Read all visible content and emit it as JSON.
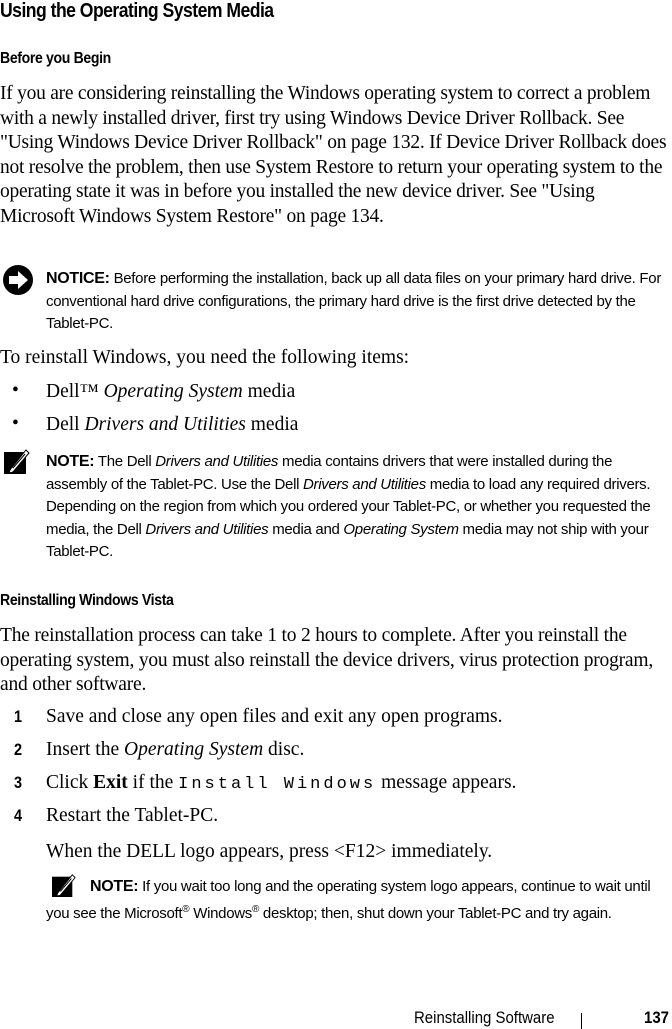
{
  "title": "Using the Operating System Media",
  "before": {
    "heading": "Before you Begin",
    "paragraph": "If you are considering reinstalling the Windows operating system to correct a problem with a newly installed driver, first try using Windows Device Driver Rollback. See \"Using Windows Device Driver Rollback\" on page 132. If Device Driver Rollback does not resolve the problem, then use System Restore to return your operating system to the operating state it was in before you installed the new device driver. See \"Using Microsoft Windows System Restore\" on page 134."
  },
  "notice": {
    "label": "NOTICE:",
    "text": "Before performing the installation, back up all data files on your primary hard drive. For conventional hard drive configurations, the primary hard drive is the first drive detected by the Tablet-PC."
  },
  "items_intro": "To reinstall Windows, you need the following items:",
  "items": [
    {
      "prefix": "Dell™ ",
      "italic": "Operating System",
      "suffix": " media"
    },
    {
      "prefix": "Dell ",
      "italic": "Drivers and Utilities",
      "suffix": " media"
    }
  ],
  "note1": {
    "label": "NOTE:",
    "t1": "The Dell ",
    "i1": "Drivers and Utilities",
    "t2": " media contains drivers that were installed during the assembly of the Tablet-PC. Use the Dell ",
    "i2": "Drivers and Utilities",
    "t3": " media to load any required drivers. Depending on the region from which you ordered your Tablet-PC, or whether you requested the media, the Dell ",
    "i3": "Drivers and Utilities",
    "t4": " media and ",
    "i4": "Operating System",
    "t5": " media may not ship with your Tablet-PC."
  },
  "vista": {
    "heading": "Reinstalling Windows Vista",
    "paragraph": "The reinstallation process can take 1 to 2 hours to complete. After you reinstall the operating system, you must also reinstall the device drivers, virus protection program, and other software."
  },
  "steps": [
    {
      "num": "1",
      "text": "Save and close any open files and exit any open programs."
    },
    {
      "num": "2",
      "pre": "Insert the ",
      "italic": "Operating System",
      "post": " disc."
    },
    {
      "num": "3",
      "pre": "Click ",
      "bold": "Exit",
      "mid": " if the ",
      "mono": "Install Windows",
      "post": " message appears."
    },
    {
      "num": "4",
      "text": "Restart the Tablet-PC."
    }
  ],
  "step4_follow": "When the DELL logo appears, press <F12> immediately.",
  "note2": {
    "label": "NOTE:",
    "t1": "If you wait too long and the operating system logo appears, continue to wait until you see the Microsoft",
    "reg": "®",
    "t2": " Windows",
    "t3": " desktop; then, shut down your Tablet-PC and try again."
  },
  "footer": {
    "section": "Reinstalling Software",
    "page": "137"
  }
}
